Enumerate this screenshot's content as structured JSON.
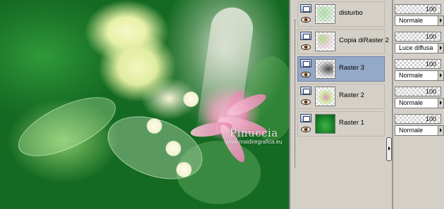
{
  "canvas": {
    "watermark_name": "Pinuccia",
    "watermark_url": "www.maidiregrafica.eu"
  },
  "layers": [
    {
      "name": "disturbo",
      "selected": false
    },
    {
      "name": "Copia diRaster 2",
      "selected": false
    },
    {
      "name": "Raster 3",
      "selected": true
    },
    {
      "name": "Raster 2",
      "selected": false
    },
    {
      "name": "Raster 1",
      "selected": false
    }
  ],
  "properties": [
    {
      "opacity": "100",
      "blend_mode": "Normale"
    },
    {
      "opacity": "100",
      "blend_mode": "Luce diffusa"
    },
    {
      "opacity": "100",
      "blend_mode": "Normale"
    },
    {
      "opacity": "100",
      "blend_mode": "Normale"
    },
    {
      "opacity": "100",
      "blend_mode": "Normale"
    }
  ],
  "colors": {
    "panel_bg": "#d4d0c8",
    "selected_row": "#94a8c8"
  }
}
